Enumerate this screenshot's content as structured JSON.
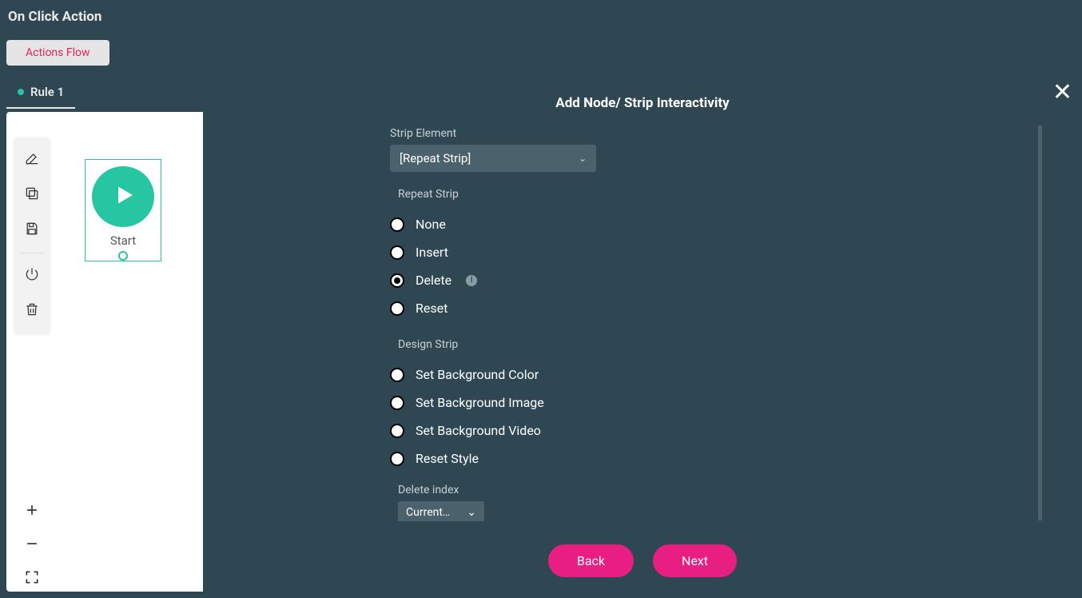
{
  "header": {
    "title": "On Click Action"
  },
  "tabs": {
    "actions_flow": "Actions Flow"
  },
  "rules": {
    "rule1": "Rule 1"
  },
  "startNode": {
    "label": "Start"
  },
  "modal": {
    "title": "Add Node/ Strip Interactivity",
    "stripElementLabel": "Strip Element",
    "stripElementValue": "[Repeat Strip]",
    "repeatSectionLabel": "Repeat Strip",
    "designSectionLabel": "Design Strip",
    "radios": {
      "none": "None",
      "insert": "Insert",
      "delete": "Delete",
      "reset": "Reset",
      "setBgColor": "Set Background Color",
      "setBgImage": "Set Background Image",
      "setBgVideo": "Set Background Video",
      "resetStyle": "Reset Style"
    },
    "deleteIndexLabel": "Delete index",
    "deleteIndexValue": "Current…",
    "back": "Back",
    "next": "Next"
  }
}
